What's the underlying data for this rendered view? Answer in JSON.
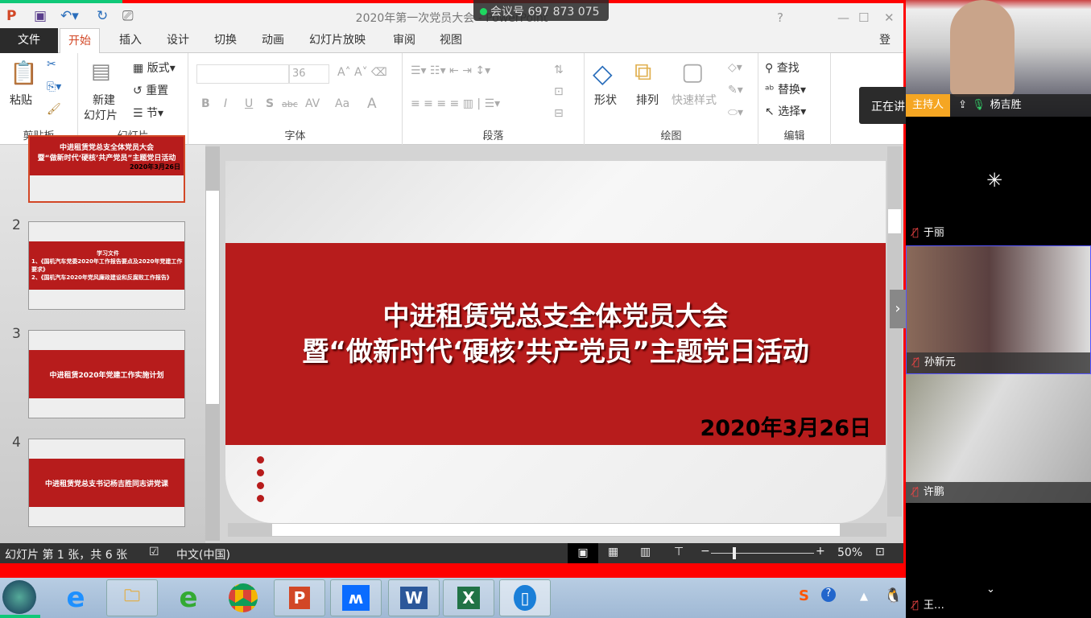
{
  "window": {
    "title": "2020年第一次党员大会 - PowerPoint",
    "meeting_id": "会议号 697 873 075",
    "help": "?",
    "min": "—",
    "max": "☐",
    "close": "✕",
    "login": "登录"
  },
  "tabs": [
    "文件",
    "开始",
    "插入",
    "设计",
    "切换",
    "动画",
    "幻灯片放映",
    "审阅",
    "视图"
  ],
  "ribbon": {
    "clipboard": {
      "paste": "粘贴",
      "label": "剪贴板"
    },
    "slides": {
      "new_slide": "新建",
      "new_slide2": "幻灯片",
      "layout": "版式",
      "reset": "重置",
      "section": "节",
      "label": "幻灯片"
    },
    "font": {
      "size": "36",
      "bold": "B",
      "italic": "I",
      "underline": "U",
      "shadow": "S",
      "strike": "abc",
      "spacing": "AV",
      "case": "Aa",
      "color": "A",
      "label": "字体"
    },
    "paragraph": {
      "label": "段落"
    },
    "drawing": {
      "shapes": "形状",
      "arrange": "排列",
      "quick_styles": "快速样式",
      "label": "绘图"
    },
    "editing": {
      "find": "查找",
      "replace": "替换",
      "select": "选择",
      "label": "编辑"
    }
  },
  "speaking_tooltip": "正在讲",
  "thumbnails": [
    {
      "num": "1",
      "lines": [
        "中进租赁党总支全体党员大会",
        "暨“做新时代‘硬核’共产党员”主题党日活动"
      ],
      "date": "2020年3月26日"
    },
    {
      "num": "2",
      "lines": [
        "学习文件",
        "1、《国机汽车党委2020年工作报告要点及2020年党建工作要求》",
        "2、《国机汽车2020年党风廉政建设和反腐败工作报告》"
      ]
    },
    {
      "num": "3",
      "lines": [
        "中进租赁2020年党建工作实施计划"
      ]
    },
    {
      "num": "4",
      "lines": [
        "中进租赁党总支书记杨吉胜同志讲党课"
      ]
    }
  ],
  "slide": {
    "title1": "中进租赁党总支全体党员大会",
    "title2": "暨“做新时代‘硬核’共产党员”主题党日活动",
    "date": "2020年3月26日"
  },
  "status": {
    "slide_info": "幻灯片 第 1 张，共 6 张",
    "language": "中文(中国)",
    "zoom": "50%",
    "zoom_value": 50
  },
  "colors": {
    "accent": "#d24726",
    "slide_red": "#b71c1c",
    "host": "#f5a623"
  },
  "participants": [
    {
      "name": "杨吉胜",
      "role": "主持人",
      "muted": false
    },
    {
      "name": "于丽",
      "muted": true
    },
    {
      "name": "孙新元",
      "muted": true
    },
    {
      "name": "许鹏",
      "muted": true
    },
    {
      "name": "王… ",
      "muted": true
    }
  ],
  "taskbar": [
    "开始",
    "Internet Explorer",
    "文件资源管理器",
    "360浏览器",
    "Chrome",
    "PowerPoint",
    "腾讯会议",
    "Word",
    "Excel",
    "手机"
  ]
}
